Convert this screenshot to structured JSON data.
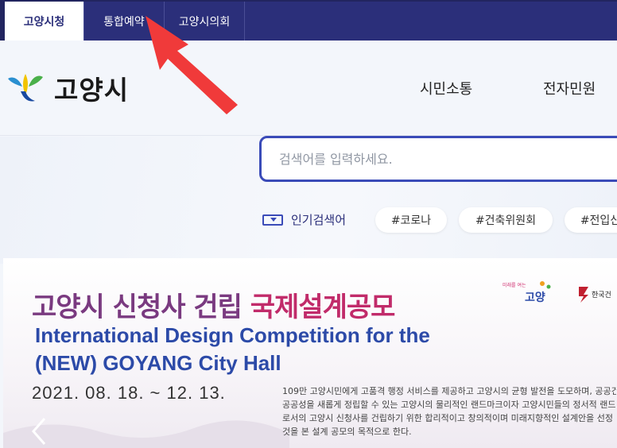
{
  "topbar": {
    "tabs": [
      {
        "label": "고양시청",
        "active": true
      },
      {
        "label": "통합예약",
        "active": false
      },
      {
        "label": "고양시의회",
        "active": false
      }
    ]
  },
  "header": {
    "logo_text": "고양시",
    "nav": [
      "시민소통",
      "전자민원"
    ]
  },
  "search": {
    "placeholder": "검색어를 입력하세요."
  },
  "popular": {
    "label": "인기검색어",
    "chips": [
      "#코로나",
      "#건축위원회",
      "#전입신"
    ]
  },
  "banner": {
    "title_part1": "고양시 신청사 건립 ",
    "title_part2": "국제설계공모",
    "title_en": "International Design Competition for the (NEW) GOYANG City Hall",
    "date": "2021. 08. 18. ~ 12. 13.",
    "description": [
      "109만 고양시민에게 고품격 행정 서비스를 제공하고 고양시의 균형 발전을 도모하며, 공공건",
      "공공성을 새롭게 정립할 수 있는 고양시의 물리적인 랜드마크이자 고양시민들의 정서적 랜드",
      "로서의 고양시 신청사를 건립하기 위한 합리적이고 창의적이며 미래지향적인 설계안을 선정",
      "것을 본 설계 공모의 목적으로 한다."
    ],
    "logo1_text": "고양",
    "logo1_sub": "미래를 여는",
    "logo2_text": "한국건"
  },
  "colors": {
    "topbar_bg": "#2b2f7a",
    "accent": "#3a4bb8",
    "title_purple": "#7a3a80",
    "title_magenta": "#c12b6a",
    "title_blue": "#2c4aa8",
    "annotation_red": "#f03a3a"
  },
  "icons": [
    "goyang-logo-icon",
    "popular-keywords-icon",
    "chevron-left-icon",
    "annotation-arrow-icon"
  ]
}
